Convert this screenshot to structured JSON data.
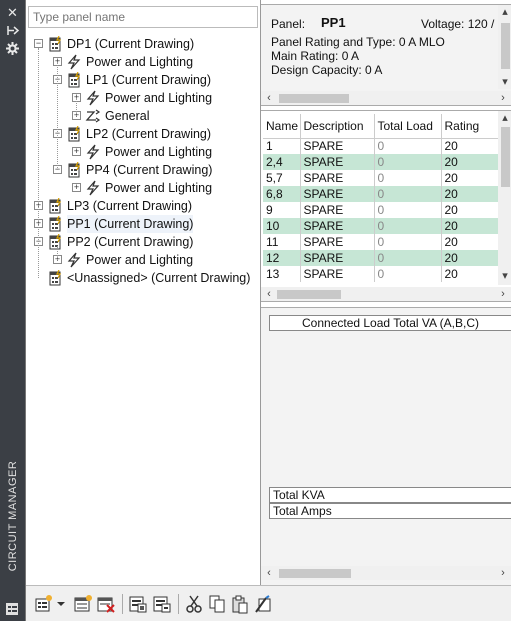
{
  "sidebar": {
    "title": "CIRCUIT MANAGER",
    "icons": [
      "close-icon",
      "pin-icon",
      "settings-icon",
      "properties-icon"
    ]
  },
  "search": {
    "placeholder": "Type panel name",
    "value": ""
  },
  "tree": {
    "nodes": [
      {
        "label": "DP1 (Current Drawing)",
        "type": "panel",
        "expanded": true
      },
      {
        "label": "Power and Lighting",
        "type": "system"
      },
      {
        "label": "LP1 (Current Drawing)",
        "type": "panel",
        "expanded": true
      },
      {
        "label": "Power and Lighting",
        "type": "system"
      },
      {
        "label": "General",
        "type": "general"
      },
      {
        "label": "LP2 (Current Drawing)",
        "type": "panel",
        "expanded": true
      },
      {
        "label": "Power and Lighting",
        "type": "system"
      },
      {
        "label": "PP4 (Current Drawing)",
        "type": "panel",
        "expanded": true
      },
      {
        "label": "Power and Lighting",
        "type": "system"
      },
      {
        "label": "LP3 (Current Drawing)",
        "type": "panel",
        "expanded": false
      },
      {
        "label": "PP1 (Current Drawing)",
        "type": "panel",
        "expanded": false,
        "selected": true
      },
      {
        "label": "PP2 (Current Drawing)",
        "type": "panel",
        "expanded": true
      },
      {
        "label": "Power and Lighting",
        "type": "system"
      },
      {
        "label": "<Unassigned> (Current Drawing)",
        "type": "panel"
      }
    ]
  },
  "panel_info": {
    "panel_label": "Panel:",
    "panel_name": "PP1",
    "voltage": "Voltage: 120 /",
    "rating_type": "Panel Rating and Type: 0 A MLO",
    "main_rating": "Main Rating: 0 A",
    "design_capacity": "Design Capacity: 0 A"
  },
  "circuits": {
    "columns": [
      "Name",
      "Description",
      "Total Load",
      "Rating"
    ],
    "rows": [
      [
        "1",
        "SPARE",
        "0",
        "20"
      ],
      [
        "2,4",
        "SPARE",
        "0",
        "20"
      ],
      [
        "5,7",
        "SPARE",
        "0",
        "20"
      ],
      [
        "6,8",
        "SPARE",
        "0",
        "20"
      ],
      [
        "9",
        "SPARE",
        "0",
        "20"
      ],
      [
        "10",
        "SPARE",
        "0",
        "20"
      ],
      [
        "11",
        "SPARE",
        "0",
        "20"
      ],
      [
        "12",
        "SPARE",
        "0",
        "20"
      ],
      [
        "13",
        "SPARE",
        "0",
        "20"
      ]
    ]
  },
  "loads": {
    "header": "Connected Load Total VA (A,B,C)",
    "total_kva": "Total KVA",
    "total_amps": "Total Amps"
  },
  "toolbar": {
    "buttons": [
      "new-panel",
      "dropdown",
      "new-circuit",
      "delete-circuit",
      "panel-schedule",
      "circuit-report",
      "cut",
      "copy",
      "paste",
      "properties"
    ]
  },
  "colors": {
    "alt_row": "#c6e6d5",
    "strip": "#3b3f45"
  }
}
